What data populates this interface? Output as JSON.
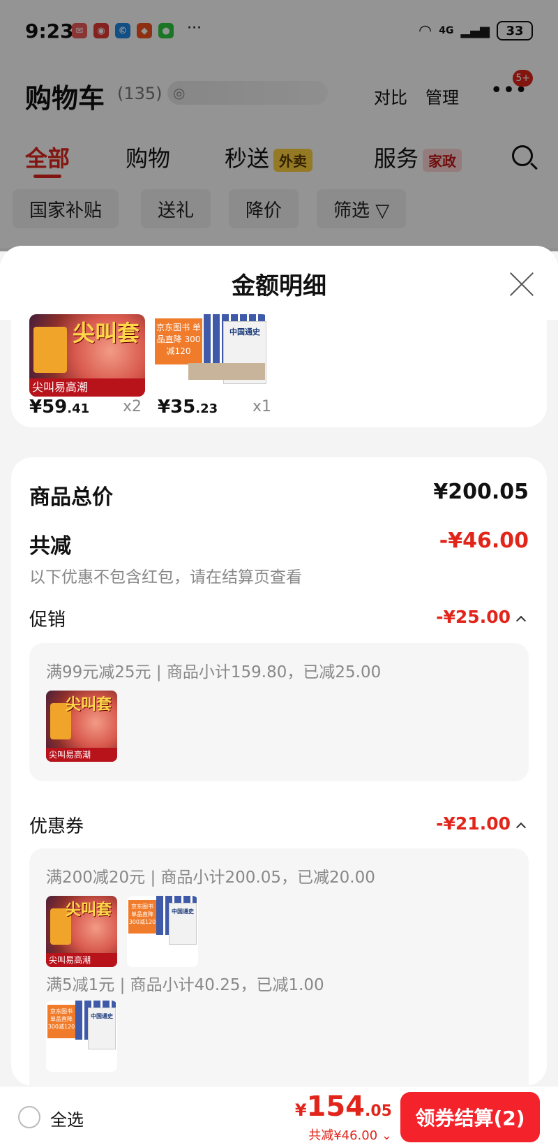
{
  "status_bar": {
    "time": "9:23",
    "dots": "···",
    "network": "4G",
    "battery": "33"
  },
  "header": {
    "title": "购物车",
    "count": "(135)",
    "compare": "对比",
    "manage": "管理",
    "more_badge": "5+"
  },
  "tabs": [
    {
      "label": "全部"
    },
    {
      "label": "购物"
    },
    {
      "label": "秒送",
      "tag": "外卖"
    },
    {
      "label": "服务",
      "tag": "家政"
    }
  ],
  "chips": [
    "国家补贴",
    "送礼",
    "降价",
    "筛选 ▽"
  ],
  "sheet": {
    "title": "金额明细",
    "items": [
      {
        "price_int": "¥59",
        "price_dec": ".41",
        "qty": "x2",
        "thumb_word": "尖叫套",
        "thumb_band": "尖叫易高潮"
      },
      {
        "price_int": "¥35",
        "price_dec": ".23",
        "qty": "x1",
        "thumb_tag": "京东图书 单品直降 300减120",
        "thumb_cover": "中国通史"
      }
    ],
    "goods_total_label": "商品总价",
    "goods_total_value": "¥200.05",
    "total_off_label": "共减",
    "total_off_value": "-¥46.00",
    "note": "以下优惠不包含红包，请在结算页查看",
    "promo": {
      "label": "促销",
      "value": "-¥25.00",
      "rule": "满99元减25元 | 商品小计159.80，已减25.00"
    },
    "coupon": {
      "label": "优惠券",
      "value": "-¥21.00",
      "rule1": "满200减20元 | 商品小计200.05，已减20.00",
      "rule2": "满5减1元 | 商品小计40.25，已减1.00"
    }
  },
  "bottom": {
    "select_all": "全选",
    "total_currency": "¥",
    "total_int": "154",
    "total_dec": ".05",
    "saved": "共减¥46.00 ⌄",
    "checkout": "领券结算(2)"
  },
  "colors": {
    "accent": "#e1251b",
    "checkout": "#f4222b"
  }
}
